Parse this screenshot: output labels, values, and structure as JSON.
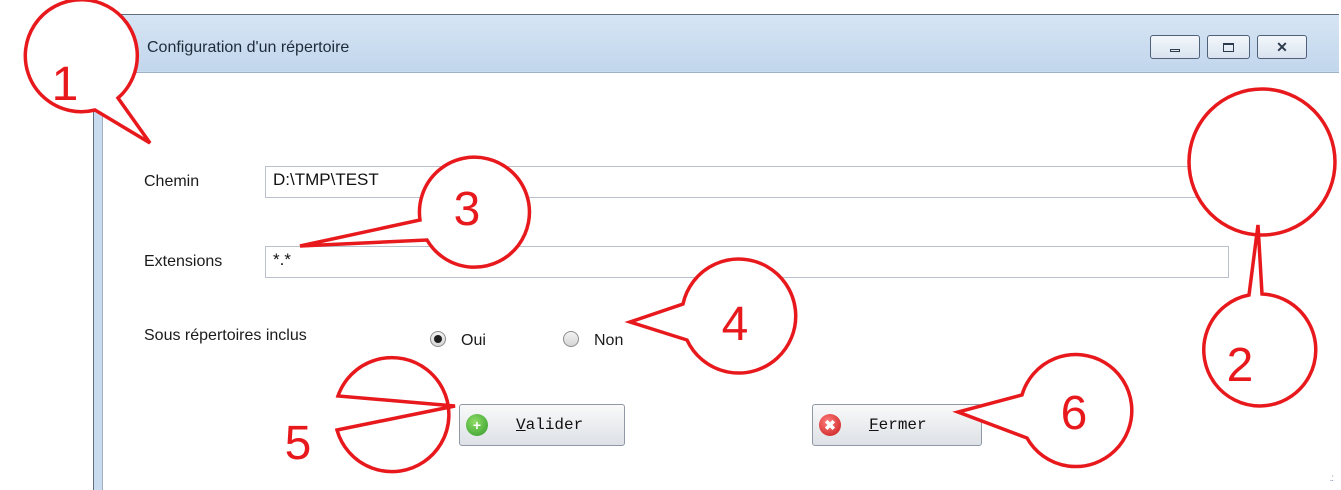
{
  "window": {
    "title": "Configuration d'un répertoire",
    "controls": {
      "minimize": "minimize",
      "maximize": "maximize",
      "close": "close"
    }
  },
  "form": {
    "path_label": "Chemin",
    "path_value": "D:\\TMP\\TEST",
    "extensions_label": "Extensions",
    "extensions_value": "*.*",
    "subdirs_label": "Sous répertoires inclus",
    "radio_yes": "Oui",
    "radio_no": "Non",
    "selected": "Oui"
  },
  "buttons": {
    "validate_letter": "V",
    "validate_rest": "alider",
    "close_letter": "F",
    "close_rest": "ermer"
  },
  "annotations": [
    "1",
    "2",
    "3",
    "4",
    "5",
    "6"
  ],
  "colors": {
    "annotation": "#e8191d",
    "frame": "#c9dcef"
  }
}
